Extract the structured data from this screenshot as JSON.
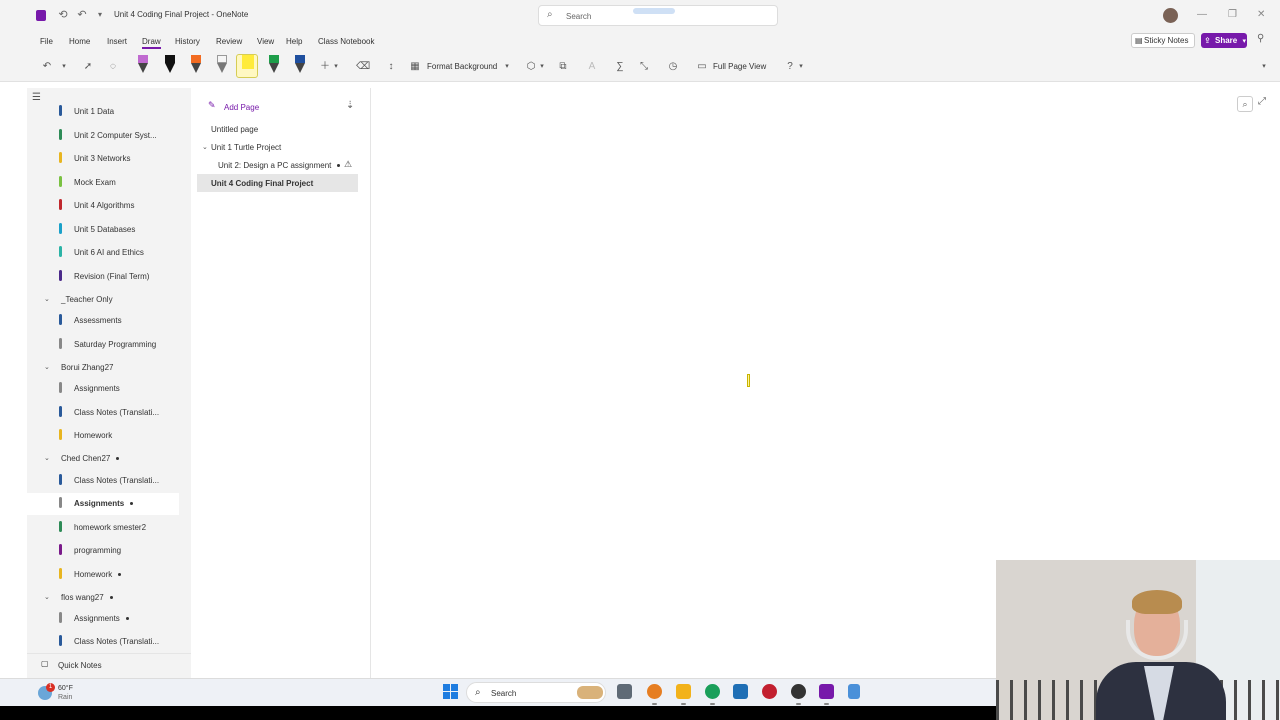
{
  "window": {
    "title": "Unit 4 Coding Final Project  -  OneNote",
    "search_placeholder": "Search"
  },
  "menu": {
    "items": [
      "File",
      "Home",
      "Insert",
      "Draw",
      "History",
      "Review",
      "View",
      "Help",
      "Class Notebook"
    ],
    "active": "Draw",
    "sticky_notes": "Sticky Notes",
    "share": "Share"
  },
  "toolbar": {
    "format_background": "Format Background",
    "full_page_view": "Full Page View"
  },
  "sections": [
    {
      "label": "Unit 1 Data",
      "color": "#2a5a9a"
    },
    {
      "label": "Unit 2 Computer Syst...",
      "color": "#2e8b57"
    },
    {
      "label": "Unit 3 Networks",
      "color": "#e8b520"
    },
    {
      "label": "Mock Exam",
      "color": "#7ac142"
    },
    {
      "label": "Unit 4 Algorithms",
      "color": "#c0282d"
    },
    {
      "label": "Unit 5 Databases",
      "color": "#1aa1c9"
    },
    {
      "label": "Unit 6 AI and Ethics",
      "color": "#2bb3a6"
    },
    {
      "label": "Revision (Final Term)",
      "color": "#4b2a8a"
    }
  ],
  "groups": [
    {
      "label": "_Teacher Only",
      "dot": false,
      "sections": [
        {
          "label": "Assessments",
          "color": "#2a5a9a",
          "dot": false
        },
        {
          "label": "Saturday Programming",
          "color": "#888888",
          "dot": false
        }
      ]
    },
    {
      "label": "Borui Zhang27",
      "dot": false,
      "sections": [
        {
          "label": "Assignments",
          "color": "#888888",
          "dot": false
        },
        {
          "label": "Class Notes (Translati...",
          "color": "#2a5a9a",
          "dot": false
        },
        {
          "label": "Homework",
          "color": "#e8b520",
          "dot": false
        }
      ]
    },
    {
      "label": "Ched Chen27",
      "dot": true,
      "sections": [
        {
          "label": "Class Notes (Translati...",
          "color": "#2a5a9a",
          "dot": false
        },
        {
          "label": "Assignments",
          "color": "#888888",
          "dot": true,
          "active": true
        },
        {
          "label": "homework smester2",
          "color": "#2e8b57",
          "dot": false
        },
        {
          "label": "programming",
          "color": "#7a1a8a",
          "dot": false
        },
        {
          "label": "Homework",
          "color": "#e8b520",
          "dot": true
        }
      ]
    },
    {
      "label": "flos wang27",
      "dot": true,
      "sections": [
        {
          "label": "Assignments",
          "color": "#888888",
          "dot": true
        },
        {
          "label": "Class Notes (Translati...",
          "color": "#2a5a9a",
          "dot": false
        }
      ]
    }
  ],
  "quick_notes": "Quick Notes",
  "pages": {
    "add_page": "Add Page",
    "items": [
      {
        "label": "Untitled page",
        "indent": 0
      },
      {
        "label": "Unit 1 Turtle Project",
        "indent": 0,
        "expanded": true
      },
      {
        "label": "Unit 2: Design a PC assignment",
        "indent": 1,
        "dot": true,
        "warning": true
      },
      {
        "label": "Unit 4 Coding Final Project",
        "indent": 0,
        "active": true
      }
    ]
  },
  "taskbar": {
    "weather_temp": "60°F",
    "weather_cond": "Rain",
    "weather_badge": "1",
    "search": "Search",
    "apps": [
      "#5f6a76",
      "#e67e22",
      "#f2b21b",
      "#1a9f5a",
      "#1f6fb5",
      "#c21f2f",
      "#333333",
      "#7719aa",
      "#4a90d9"
    ]
  }
}
